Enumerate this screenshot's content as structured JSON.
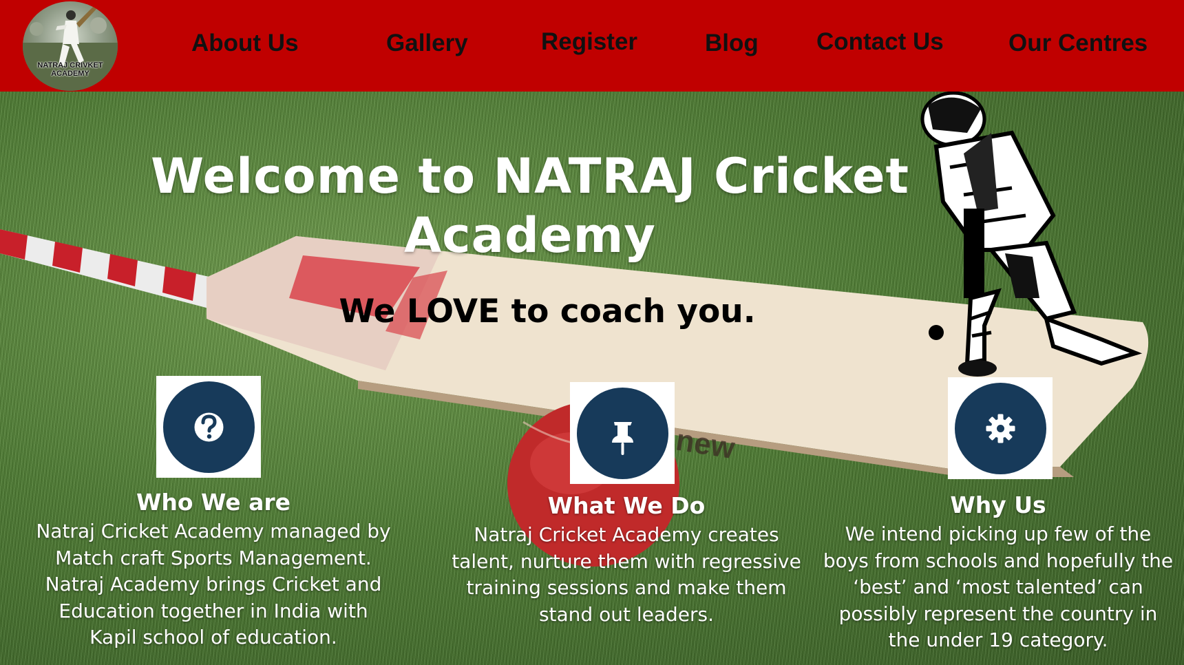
{
  "header": {
    "logo": {
      "line1": "NATRAJ CRIVKET",
      "line2": "ACADEMY",
      "icon": "batsman-logo-icon"
    },
    "nav": [
      {
        "label": "About Us"
      },
      {
        "label": "Gallery"
      },
      {
        "label": "Register"
      },
      {
        "label": "Blog"
      },
      {
        "label": "Contact Us"
      },
      {
        "label": "Our Centres"
      }
    ]
  },
  "hero": {
    "title": "Welcome to NATRAJ Cricket Academy",
    "tagline": "We LOVE to coach you.",
    "background_icons": [
      "cricket-bat-icon",
      "cricket-ball-icon",
      "batsman-silhouette-icon"
    ],
    "features": [
      {
        "icon": "question-icon",
        "title": "Who We are",
        "body": "Natraj Cricket Academy managed by Match craft Sports Management. Natraj Academy brings Cricket and Education together in India with Kapil school of education."
      },
      {
        "icon": "pushpin-icon",
        "title": "What We Do",
        "body": "Natraj Cricket Academy creates talent, nurture them with regressive training sessions and make them stand out leaders."
      },
      {
        "icon": "gear-icon",
        "title": "Why Us",
        "body": "We intend picking up few of the boys from schools and hopefully the ‘best’ and ‘most talented’ can possibly represent the country in the under 19 category."
      }
    ]
  },
  "colors": {
    "header_bg": "#c00000",
    "icon_circle": "#173a5a",
    "grass": "#4c7a31",
    "title_text": "#ffffff"
  }
}
